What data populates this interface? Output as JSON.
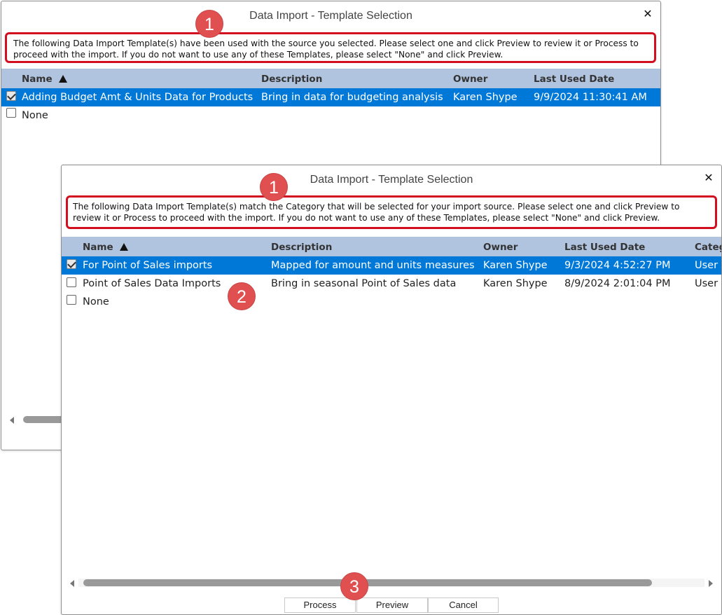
{
  "back_dialog": {
    "title": "Data Import - Template Selection",
    "close_glyph": "✕",
    "info_text": "The following Data Import Template(s) have been used with the source you selected. Please select one and click Preview to review it or Process to proceed with the import. If you do not want to use any of these Templates, please select \"None\" and click Preview.",
    "columns": {
      "name": "Name",
      "description": "Description",
      "owner": "Owner",
      "last_used": "Last Used Date"
    },
    "rows": [
      {
        "checked": true,
        "selected": true,
        "name": "Adding Budget Amt & Units Data for Products",
        "description": "Bring in data for budgeting analysis",
        "owner": "Karen Shype",
        "last_used": "9/9/2024 11:30:41 AM"
      },
      {
        "checked": false,
        "selected": false,
        "name": "None",
        "description": "",
        "owner": "",
        "last_used": ""
      }
    ]
  },
  "front_dialog": {
    "title": "Data Import - Template Selection",
    "close_glyph": "✕",
    "info_text": "The following Data Import Template(s) match the Category that will be selected for your import source. Please select one and click Preview to review it or Process to proceed with the import. If you do not want to use any of these Templates, please select \"None\" and click Preview.",
    "columns": {
      "name": "Name",
      "description": "Description",
      "owner": "Owner",
      "last_used": "Last Used Date",
      "category": "Categ"
    },
    "rows": [
      {
        "checked": true,
        "selected": true,
        "name": "For Point of Sales imports",
        "description": "Mapped for amount and units measures",
        "owner": "Karen Shype",
        "last_used": "9/3/2024 4:52:27 PM",
        "category": "User"
      },
      {
        "checked": false,
        "selected": false,
        "name": "Point of Sales Data Imports",
        "description": "Bring in seasonal Point of Sales data",
        "owner": "Karen Shype",
        "last_used": "8/9/2024 2:01:04 PM",
        "category": "User"
      },
      {
        "checked": false,
        "selected": false,
        "name": "None",
        "description": "",
        "owner": "",
        "last_used": "",
        "category": ""
      }
    ],
    "buttons": {
      "process": "Process",
      "preview": "Preview",
      "cancel": "Cancel"
    }
  },
  "callouts": {
    "back_info": "1",
    "front_info": "1",
    "grid_rows": "2",
    "buttons": "3"
  },
  "colors": {
    "header_bg": "#b1c4df",
    "selected_row_bg": "#0078d7",
    "callout_border": "#d10f1f",
    "callout_circle": "#e05050"
  }
}
